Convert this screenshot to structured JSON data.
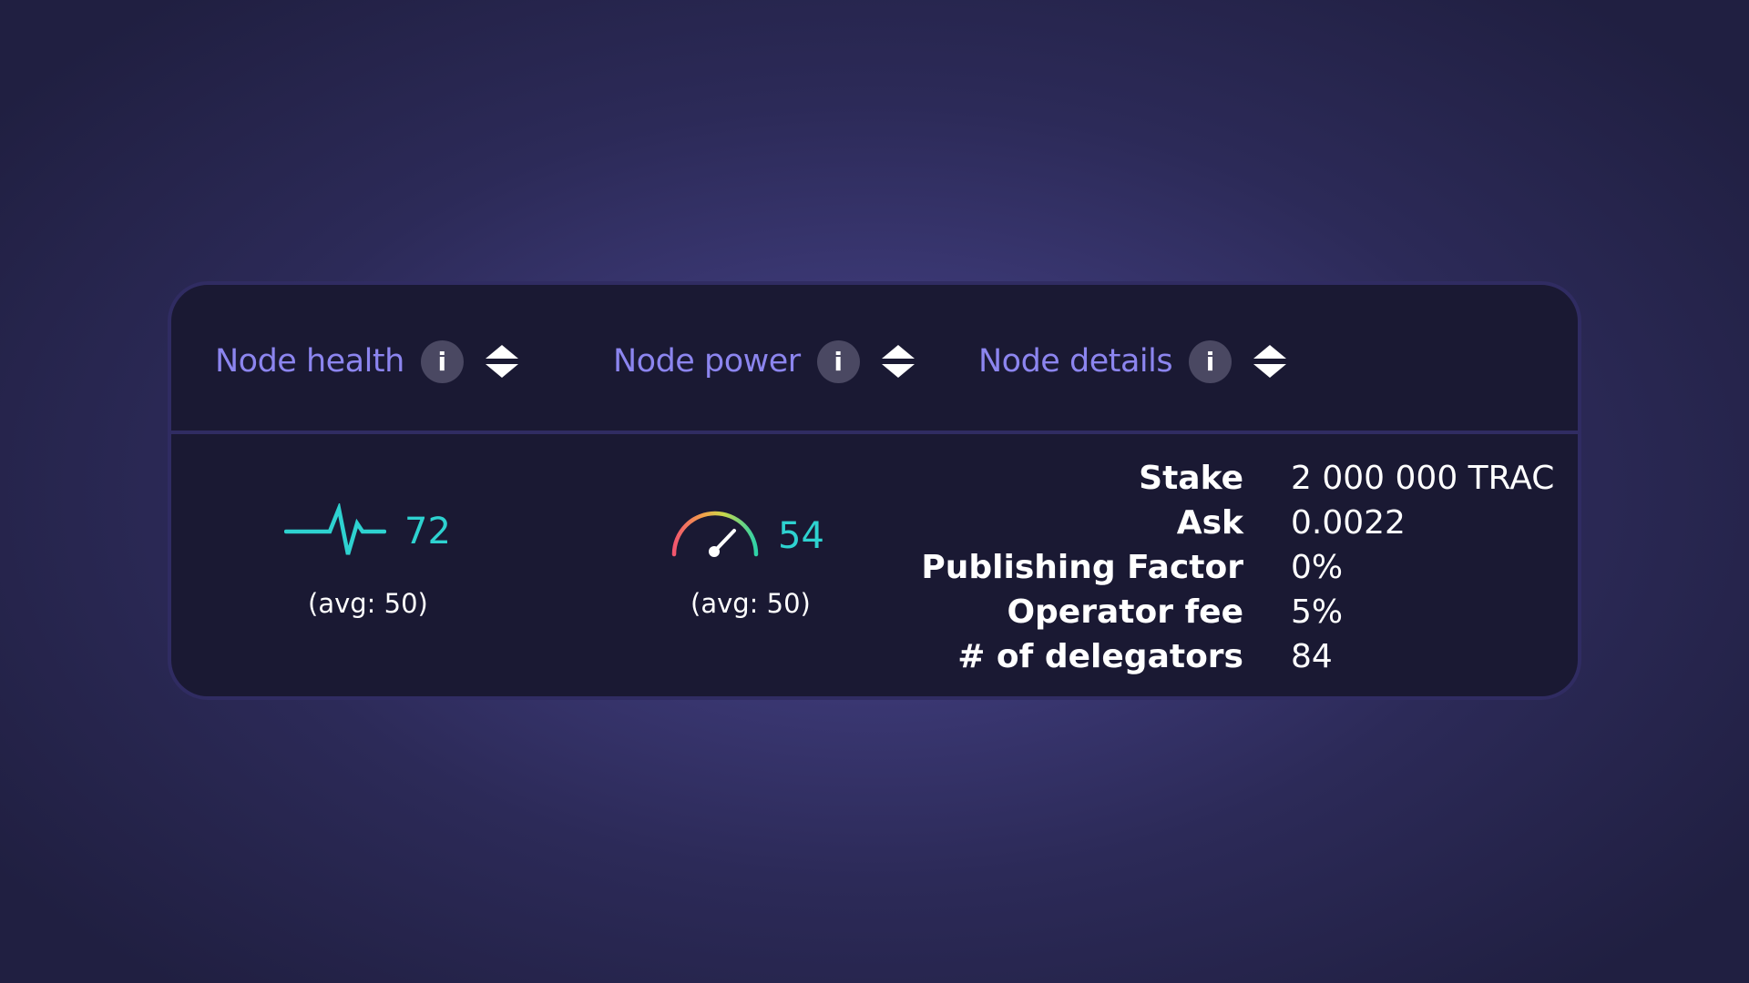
{
  "columns": [
    {
      "label": "Node health",
      "info_icon": "info-icon",
      "sort_icon": "sort-icon"
    },
    {
      "label": "Node power",
      "info_icon": "info-icon",
      "sort_icon": "sort-icon"
    },
    {
      "label": "Node details",
      "info_icon": "info-icon",
      "sort_icon": "sort-icon"
    }
  ],
  "info_glyph": "i",
  "health": {
    "icon": "heartbeat-icon",
    "value": "72",
    "avg": "(avg: 50)"
  },
  "power": {
    "icon": "gauge-icon",
    "value": "54",
    "avg": "(avg: 50)"
  },
  "details": [
    {
      "label": "Stake",
      "value": "2 000 000 TRAC"
    },
    {
      "label": "Ask",
      "value": "0.0022"
    },
    {
      "label": "Publishing Factor",
      "value": "0%"
    },
    {
      "label": "Operator fee",
      "value": "5%"
    },
    {
      "label": "# of delegators",
      "value": "84"
    }
  ],
  "colors": {
    "accent": "#8c85ef",
    "metric": "#2ed2d0",
    "card": "#1a1933",
    "border": "#302c62",
    "info_button": "#4a4862"
  }
}
